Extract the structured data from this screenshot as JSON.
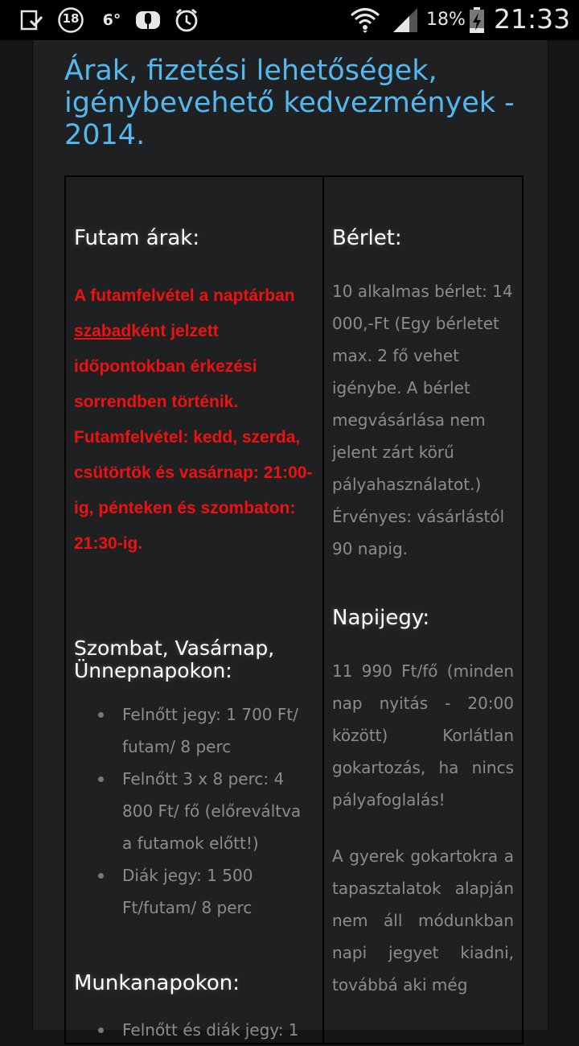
{
  "status_bar": {
    "notification_icons": [
      "download-icon",
      "age-18-icon",
      "weather-icon",
      "voice-recorder-icon",
      "alarm-icon"
    ],
    "temperature": "6°",
    "age_badge": "18",
    "battery_percent": "18%",
    "time": "21:33"
  },
  "page": {
    "title": "Árak, fizetési lehetőségek, igénybevehető kedvezmények - 2014."
  },
  "left": {
    "heading": "Futam árak:",
    "notice_part1": "A futamfelvétel a naptárban ",
    "notice_link": "szabad",
    "notice_part2": "ként jelzett időpontokban érkezési sorrendben történik. Futamfelvétel: kedd, szerda, csütörtök és vasárnap: 21:00-ig, pénteken és szombaton: 21:30-ig.",
    "weekend_heading": "Szombat, Vasárnap, Ünnepnapokon:",
    "weekend_items": [
      "Felnőtt jegy: 1 700 Ft/ futam/ 8 perc",
      "Felnőtt 3 x 8 perc: 4 800 Ft/ fő (előreváltva a futamok előtt!)",
      "Diák jegy: 1 500 Ft/futam/ 8 perc"
    ],
    "weekday_heading": "Munkanapokon:",
    "weekday_first_item_partial": "Felnőtt és diák jegy: 1"
  },
  "right": {
    "heading": "Bérlet:",
    "berlet_text": "10 alkalmas bérlet: 14 000,-Ft (Egy bérletet max. 2 fő vehet igénybe. A bérlet megvásárlása nem jelent zárt körű pályahasználatot.) Érvényes: vásárlástól 90 napig.",
    "napijegy_heading": "Napijegy:",
    "napijegy_text": "11 990 Ft/fő (minden nap nyitás - 20:00 között) Korlátlan gokartozás, ha nincs pályafoglalás!",
    "kids_text": "A gyerek gokartokra a tapasztalatok alapján nem áll módunkban napi jegyet kiadni, továbbá aki még"
  }
}
